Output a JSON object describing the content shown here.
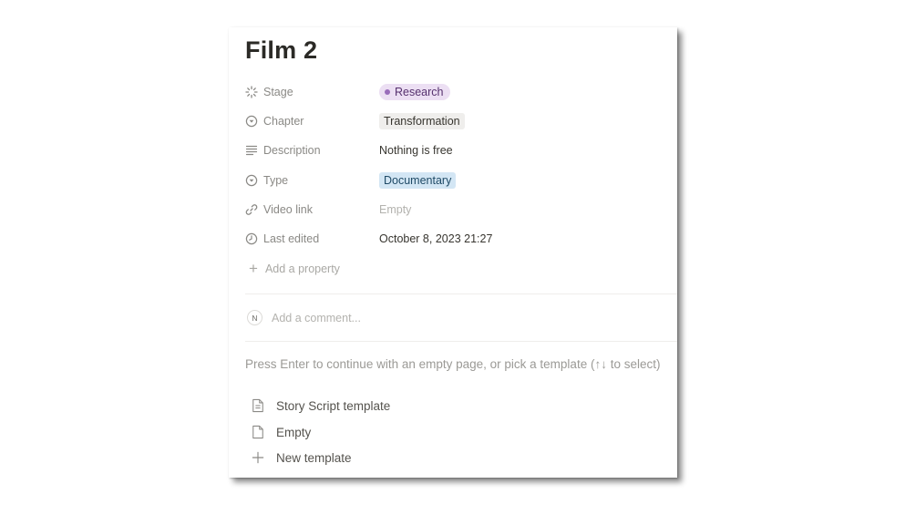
{
  "page": {
    "title": "Film 2"
  },
  "properties": [
    {
      "name": "Stage",
      "icon": "status-icon",
      "value": "Research",
      "kind": "status",
      "color": "#ecdff3"
    },
    {
      "name": "Chapter",
      "icon": "select-icon",
      "value": "Transformation",
      "kind": "select",
      "color": "#efeeec"
    },
    {
      "name": "Description",
      "icon": "text-icon",
      "value": "Nothing is free",
      "kind": "text"
    },
    {
      "name": "Type",
      "icon": "select-icon",
      "value": "Documentary",
      "kind": "select",
      "color": "#d3e6f4"
    },
    {
      "name": "Video link",
      "icon": "link-icon",
      "value": "Empty",
      "kind": "empty"
    },
    {
      "name": "Last edited",
      "icon": "clock-icon",
      "value": "October 8, 2023 21:27",
      "kind": "text"
    }
  ],
  "add_property": {
    "label": "Add a property"
  },
  "comment": {
    "avatar": "N",
    "placeholder": "Add a comment..."
  },
  "template_hint": "Press Enter to continue with an empty page, or pick a template (↑↓ to select)",
  "templates": [
    {
      "label": "Story Script template",
      "icon": "document-icon"
    },
    {
      "label": "Empty",
      "icon": "page-icon"
    },
    {
      "label": "New template",
      "icon": "plus-icon"
    }
  ]
}
